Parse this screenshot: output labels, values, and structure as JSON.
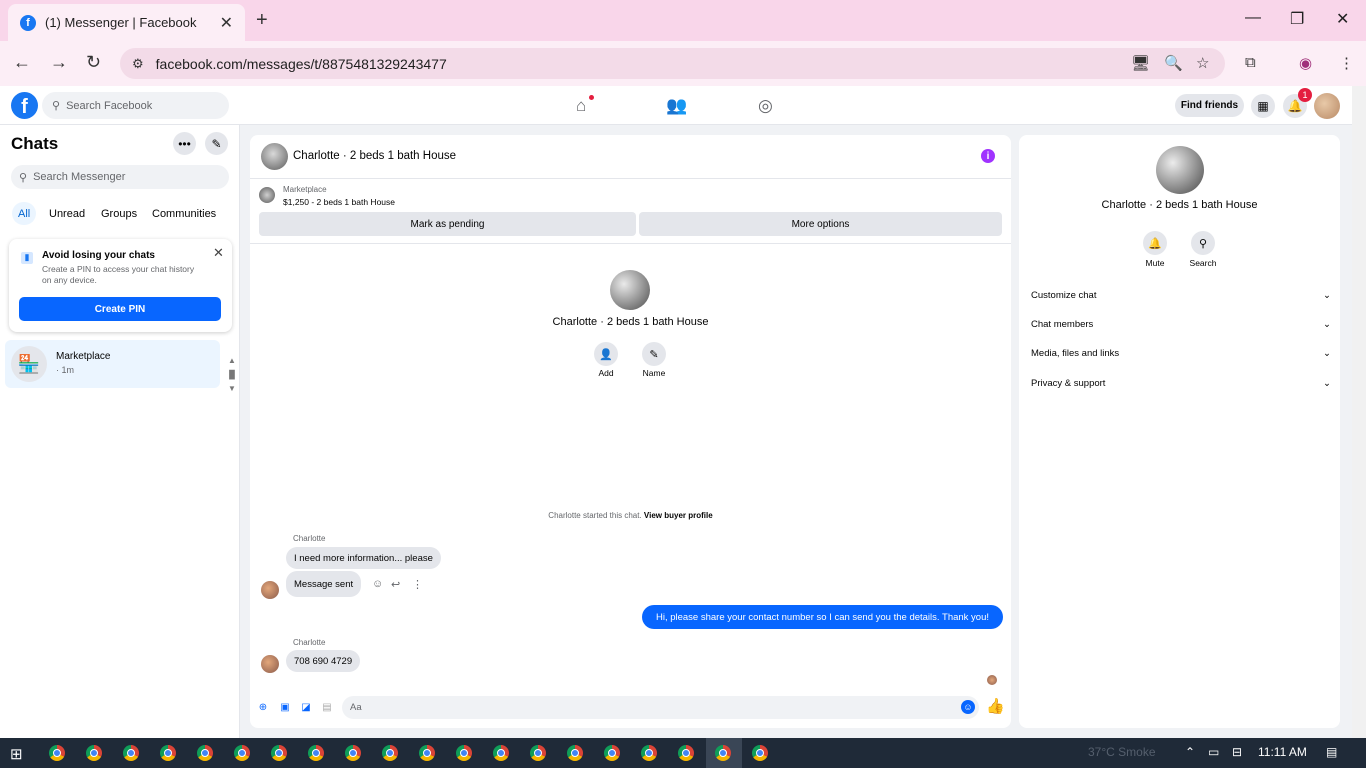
{
  "browser": {
    "tab_title": "(1) Messenger | Facebook",
    "tab_close": "✕",
    "new_tab": "+",
    "url": "facebook.com/messages/t/8875481329243477",
    "controls": {
      "minimize": "—",
      "restore": "❐",
      "close": "✕"
    },
    "nav": {
      "back": "←",
      "forward": "→",
      "reload": "↻"
    }
  },
  "fb": {
    "logo": "f",
    "search_placeholder": "Search Facebook",
    "find_friends": "Find friends",
    "notification_count": "1"
  },
  "sidebar": {
    "title": "Chats",
    "search_placeholder": "Search Messenger",
    "filters": [
      "All",
      "Unread",
      "Groups",
      "Communities"
    ],
    "pin_card": {
      "title": "Avoid losing your chats",
      "text": "Create a PIN to access your chat history on any device.",
      "button": "Create PIN"
    },
    "chats": [
      {
        "name": "Marketplace",
        "time": "· 1m"
      }
    ]
  },
  "conversation": {
    "title": "Charlotte · 2 beds 1 bath House",
    "marketplace_label": "Marketplace",
    "listing": "$1,250 - 2 beds 1 bath House",
    "mark_pending": "Mark as pending",
    "more_options": "More options",
    "center_name": "Charlotte · 2 beds 1 bath House",
    "add_label": "Add",
    "name_label": "Name",
    "started_text": "Charlotte started this chat.",
    "view_profile": "View buyer profile",
    "messages": [
      {
        "sender": "Charlotte",
        "text": "I need more information... please"
      },
      {
        "sender": "",
        "text": "Message sent"
      },
      {
        "sender": "me",
        "text": "Hi, please share your contact number so I can send you the details. Thank you!"
      },
      {
        "sender": "Charlotte",
        "text": "708 690 4729"
      }
    ],
    "composer_placeholder": "Aa"
  },
  "right_panel": {
    "name": "Charlotte · 2 beds 1 bath House",
    "mute": "Mute",
    "search": "Search",
    "sections": [
      "Customize chat",
      "Chat members",
      "Media, files and links",
      "Privacy & support"
    ]
  },
  "taskbar": {
    "weather": "37°C  Smoke",
    "time": "11:11 AM"
  },
  "colors": {
    "accent": "#0866ff",
    "brand": "#1877f2",
    "tab_bar": "#f9d6ea",
    "info": "#a033ff"
  }
}
